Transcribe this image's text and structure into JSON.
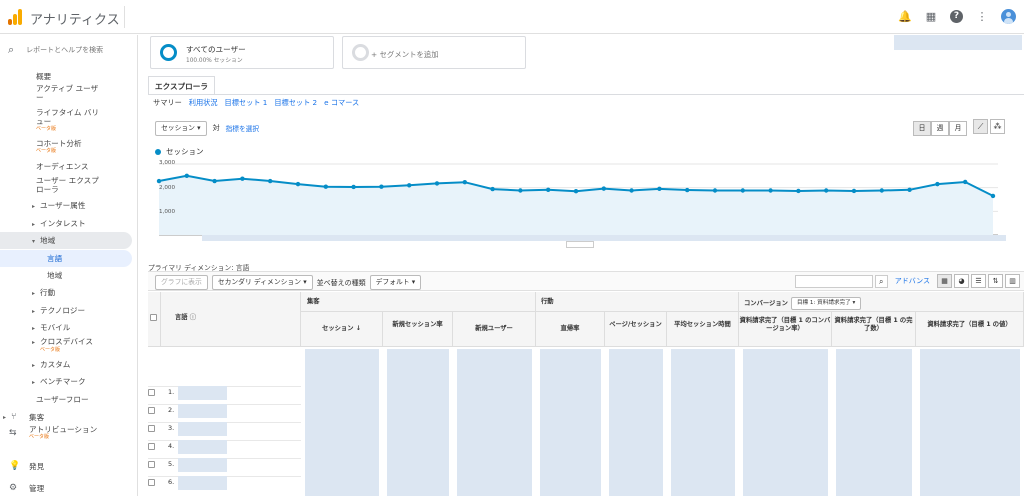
{
  "app": {
    "title": "アナリティクス"
  },
  "sidebar": {
    "search_placeholder": "レポートとヘルプを検索",
    "items": [
      {
        "label": "概要"
      },
      {
        "label": "アクティブ ユーザー"
      },
      {
        "label": "ライフタイム バリュー",
        "badge": "ベータ版"
      },
      {
        "label": "コホート分析",
        "badge": "ベータ版"
      },
      {
        "label": "オーディエンス"
      },
      {
        "label": "ユーザー エクスプローラ"
      },
      {
        "label": "ユーザー属性"
      },
      {
        "label": "インタレスト"
      },
      {
        "label": "地域"
      },
      {
        "label": "言語"
      },
      {
        "label": "地域"
      },
      {
        "label": "行動"
      },
      {
        "label": "テクノロジー"
      },
      {
        "label": "モバイル"
      },
      {
        "label": "クロスデバイス",
        "badge": "ベータ版"
      },
      {
        "label": "カスタム"
      },
      {
        "label": "ベンチマーク"
      },
      {
        "label": "ユーザーフロー"
      }
    ],
    "main": [
      {
        "label": "集客"
      },
      {
        "label": "アトリビューション",
        "badge": "ベータ版"
      },
      {
        "label": "発見"
      },
      {
        "label": "管理"
      }
    ]
  },
  "segments": {
    "all_users": "すべてのユーザー",
    "all_users_sub": "100.00% セッション",
    "add": "+ セグメントを追加"
  },
  "tabs": {
    "explorer": "エクスプローラ"
  },
  "subtabs": [
    "サマリー",
    "利用状況",
    "目標セット 1",
    "目標セット 2",
    "e コマース"
  ],
  "controls": {
    "metric": "セッション",
    "vs": "対",
    "select_metric": "指標を選択",
    "time": [
      "日",
      "週",
      "月"
    ]
  },
  "chart_data": {
    "type": "line",
    "series": [
      {
        "name": "セッション",
        "values": [
          2280,
          2500,
          2280,
          2380,
          2280,
          2150,
          2040,
          2030,
          2040,
          2100,
          2180,
          2230,
          1940,
          1880,
          1910,
          1850,
          1960,
          1880,
          1950,
          1900,
          1880,
          1880,
          1880,
          1860,
          1880,
          1860,
          1880,
          1910,
          2150,
          2240,
          1650
        ]
      }
    ],
    "ylabels": [
      "3,000",
      "2,000",
      "1,000"
    ],
    "ylim": [
      0,
      3000
    ],
    "grid": true,
    "xlabel": "",
    "ylabel": ""
  },
  "table_controls": {
    "primary_dimension": "プライマリ ディメンション: 言語",
    "plot_rows": "グラフに表示",
    "secondary": "セカンダリ ディメンション",
    "sort_type_label": "並べ替えの種類",
    "sort_type": "デフォルト",
    "advanced": "アドバンス"
  },
  "table": {
    "dimension": "言語",
    "groups": [
      "集客",
      "行動",
      "コンバージョン"
    ],
    "goal_select": "目標 1: 資料請求完了",
    "columns": [
      "セッション",
      "新規セッション率",
      "新規ユーザー",
      "直帰率",
      "ページ/セッション",
      "平均セッション時間",
      "資料請求完了（目標 1 のコンバージョン率）",
      "資料請求完了（目標 1 の完了数）",
      "資料請求完了（目標 1 の値）"
    ],
    "rows": [
      "1.",
      "2.",
      "3.",
      "4.",
      "5.",
      "6."
    ]
  },
  "colors": {
    "series": "#058dc7",
    "accent": "#1a73e8",
    "orange": "#e8710a"
  }
}
